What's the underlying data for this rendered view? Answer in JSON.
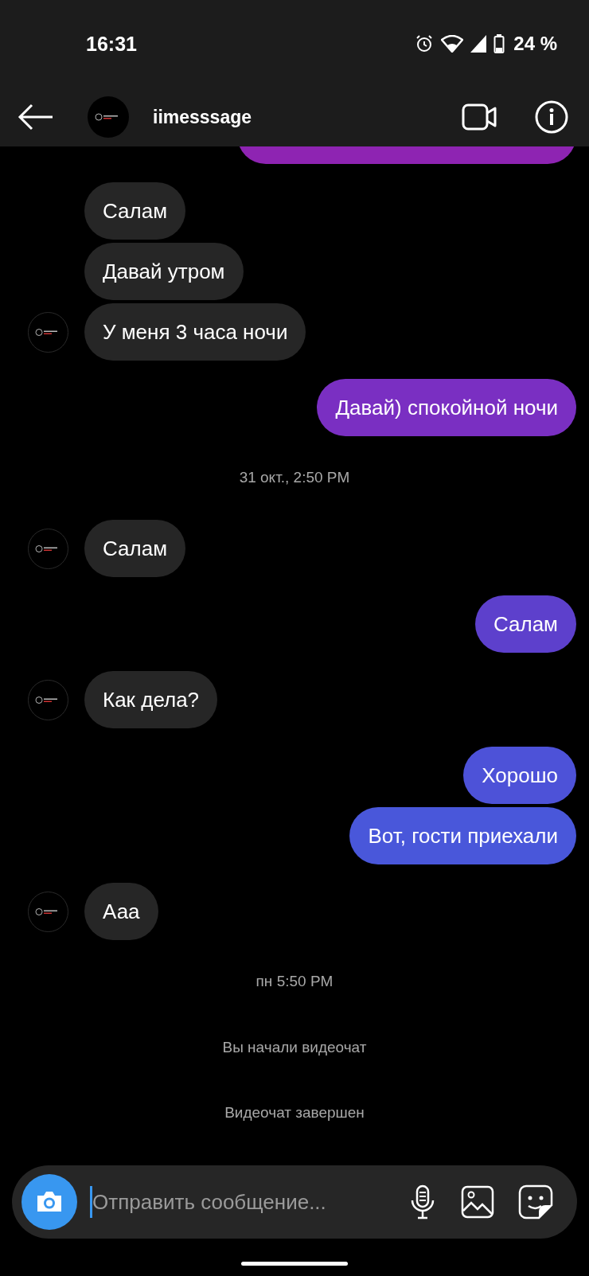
{
  "status_bar": {
    "time": "16:31",
    "battery": "24 %"
  },
  "header": {
    "name": "iimesssage"
  },
  "thread": [
    {
      "kind": "incoming",
      "messages": [
        {
          "text": "Салам"
        },
        {
          "text": "Давай утром"
        },
        {
          "text": "У меня 3 часа ночи"
        }
      ]
    },
    {
      "kind": "outgoing",
      "messages": [
        {
          "text": "Давай) спокойной ночи",
          "color": "#7a2fc2"
        }
      ]
    },
    {
      "kind": "timestamp",
      "text": "31 окт., 2:50 PM"
    },
    {
      "kind": "incoming",
      "messages": [
        {
          "text": "Салам"
        }
      ]
    },
    {
      "kind": "outgoing",
      "messages": [
        {
          "text": "Салам",
          "color": "#5d40cc"
        }
      ]
    },
    {
      "kind": "incoming",
      "messages": [
        {
          "text": "Как дела?"
        }
      ]
    },
    {
      "kind": "outgoing",
      "messages": [
        {
          "text": "Хорошо",
          "color": "#4d52d8"
        },
        {
          "text": "Вот, гости приехали",
          "color": "#4957da"
        }
      ]
    },
    {
      "kind": "incoming",
      "messages": [
        {
          "text": "Ааа"
        }
      ]
    },
    {
      "kind": "timestamp",
      "text": "пн 5:50 PM"
    },
    {
      "kind": "event",
      "text": "Вы начали видеочат"
    },
    {
      "kind": "event",
      "text": "Видеочат завершен"
    }
  ],
  "composer": {
    "placeholder": "Отправить сообщение..."
  }
}
